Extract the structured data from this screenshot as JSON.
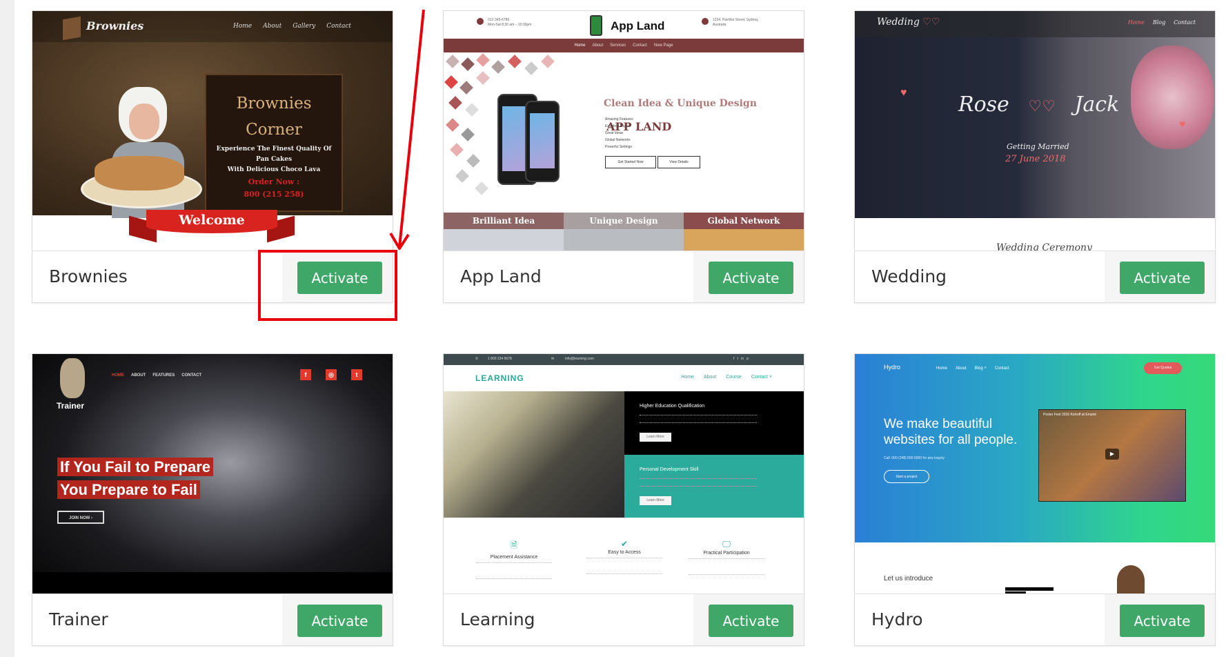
{
  "themes": [
    {
      "name": "Brownies",
      "activate_label": "Activate",
      "preview": {
        "brand": "Brownies",
        "nav": [
          "Home",
          "About",
          "Gallery",
          "Contact"
        ],
        "title_line1": "Brownies",
        "title_line2": "Corner",
        "tagline": [
          "Experience The Finest Quality Of",
          "Pan Cakes",
          "With Delicious Choco Lava"
        ],
        "order_label": "Order Now :",
        "phone": "800 (215 258)",
        "ribbon": "Welcome"
      }
    },
    {
      "name": "App Land",
      "activate_label": "Activate",
      "preview": {
        "brand": "App Land",
        "contact_left": [
          "012-345-6789",
          "Mon-Sat 8:30 am – 10:30pm"
        ],
        "contact_right": [
          "1234, Pavilion Street, Sydney,",
          "Australia"
        ],
        "nav": [
          "Home",
          "About",
          "Services",
          "Contact",
          "New Page"
        ],
        "headline": "APP LAND",
        "subheadline": "Clean Idea & Unique Design",
        "features": [
          "Amazing Features",
          "Excellent Layout",
          "Great Ideas",
          "Global Networks",
          "Powerful Settings"
        ],
        "buttons": [
          "Get Started Now",
          "View Details"
        ],
        "bottom_blocks": [
          "Brilliant Idea",
          "Unique Design",
          "Global Network"
        ]
      }
    },
    {
      "name": "Wedding",
      "activate_label": "Activate",
      "preview": {
        "brand": "Wedding",
        "nav": [
          "Home",
          "Blog",
          "Contact"
        ],
        "bride": "Rose",
        "groom": "Jack",
        "subtitle": "Getting Married",
        "date": "27 June 2018",
        "section": "Wedding Ceremony"
      }
    },
    {
      "name": "Trainer",
      "activate_label": "Activate",
      "preview": {
        "brand": "Trainer",
        "nav": [
          "HOME",
          "ABOUT",
          "FEATURES",
          "CONTACT"
        ],
        "social": [
          "f",
          "◎",
          "t"
        ],
        "headline_line1": "If You Fail to Prepare",
        "headline_line2": "You Prepare to Fail",
        "cta": "JOIN NOW ›"
      }
    },
    {
      "name": "Learning",
      "activate_label": "Activate",
      "preview": {
        "brand": "LEARNING",
        "phone": "1 800 234 5678",
        "email": "info@learning.com",
        "nav": [
          "Home",
          "About",
          "Course",
          "Contact ˅"
        ],
        "block1_title": "Higher Education Qualification",
        "block2_title": "Personal Development Skill",
        "learn_more": "Learn More",
        "features": [
          {
            "icon": "document-icon",
            "glyph": "🗎",
            "title": "Placement Assistance"
          },
          {
            "icon": "check-icon",
            "glyph": "✔",
            "title": "Easy to Access"
          },
          {
            "icon": "monitor-icon",
            "glyph": "🖵",
            "title": "Practical Participation"
          }
        ]
      }
    },
    {
      "name": "Hydro",
      "activate_label": "Activate",
      "preview": {
        "brand": "Hydro",
        "nav": [
          "Home",
          "About",
          "Blog ˅",
          "Contact"
        ],
        "quote_button": "Get Quotes",
        "headline_line1": "We make beautiful",
        "headline_line2": "websites for all people.",
        "subtext": "Call: 000 (248) 000 0000 for any inquiry",
        "cta": "Start a project",
        "video_title": "Poster Fest 2016 Kickoff at Empire",
        "intro": "Let us introduce"
      }
    }
  ],
  "annotation": {
    "color": "#e8000b",
    "target": "Brownies activate button"
  },
  "colors": {
    "activate": "#3fa869",
    "footer_gray": "#f5f5f5",
    "page_strip": "#f0f0f0"
  }
}
